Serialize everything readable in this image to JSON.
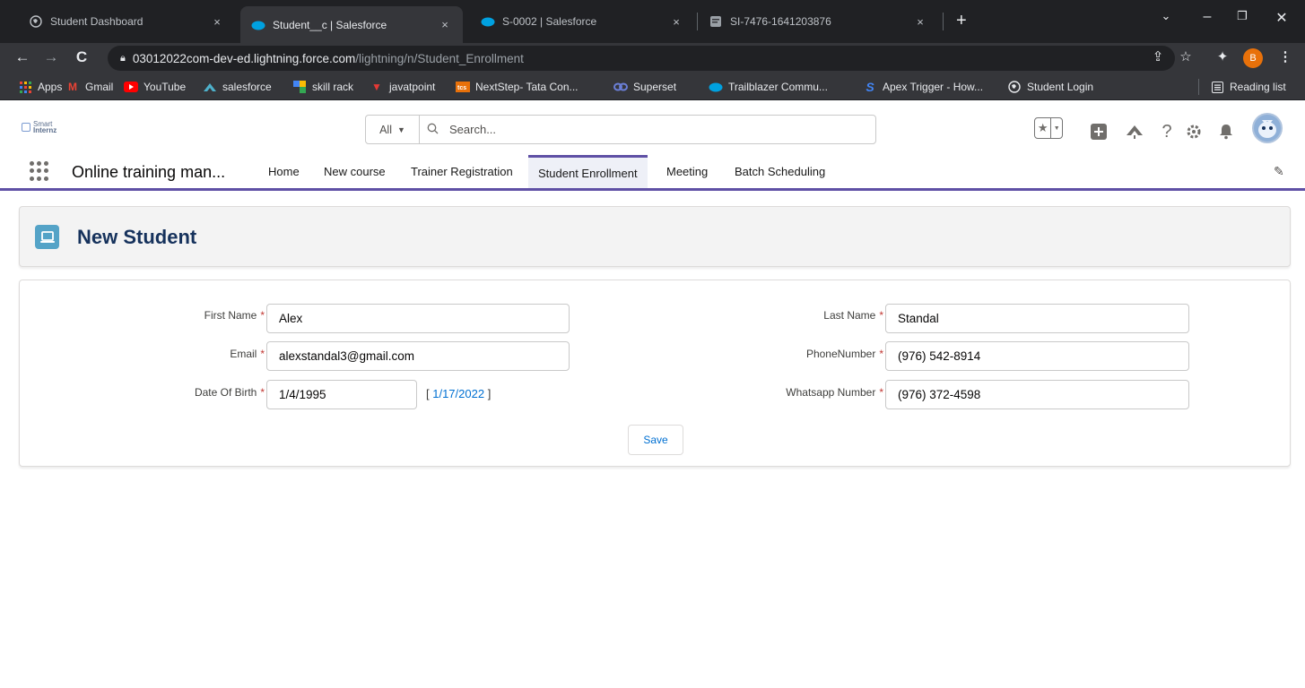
{
  "browser": {
    "tabs": [
      {
        "title": "Student Dashboard",
        "close": "×"
      },
      {
        "title": "Student__c | Salesforce",
        "close": "×"
      },
      {
        "title": "S-0002 | Salesforce",
        "close": "×"
      },
      {
        "title": "SI-7476-1641203876",
        "close": "×"
      }
    ],
    "new_tab": "+",
    "url_host": "03012022com-dev-ed.lightning.force.com",
    "url_path": "/lightning/n/Student_Enrollment",
    "profile_initial": "B",
    "bookmarks": [
      "Apps",
      "Gmail",
      "YouTube",
      "salesforce",
      "skill rack",
      "javatpoint",
      "NextStep- Tata Con...",
      "Superset",
      "Trailblazer Commu...",
      "Apex Trigger - How...",
      "Student Login"
    ],
    "reading_list": "Reading list"
  },
  "sf": {
    "logo_text_1": "Smart",
    "logo_text_2": "Internz",
    "search_scope": "All",
    "search_placeholder": "Search...",
    "app_name": "Online training man...",
    "nav": [
      "Home",
      "New course",
      "Trainer Registration",
      "Student Enrollment",
      "Meeting",
      "Batch Scheduling"
    ],
    "active_nav": "Student Enrollment"
  },
  "page": {
    "title": "New Student",
    "required_mark": "*",
    "fields": {
      "first_name": {
        "label": "First Name",
        "value": "Alex"
      },
      "last_name": {
        "label": "Last Name",
        "value": "Standal"
      },
      "email": {
        "label": "Email",
        "value": "alexstandal3@gmail.com"
      },
      "phone": {
        "label": "PhoneNumber",
        "value": "(976) 542-8914"
      },
      "dob": {
        "label": "Date Of Birth",
        "value": "1/4/1995",
        "today_open": "[ ",
        "today": "1/17/2022",
        "today_close": " ]"
      },
      "whatsapp": {
        "label": "Whatsapp Number",
        "value": "(976) 372-4598"
      }
    },
    "save_label": "Save"
  },
  "colors": {
    "brand": "#5f50a5",
    "link": "#0070d2",
    "required": "#c23934",
    "title": "#16325c",
    "icon_bg": "#54a3c7"
  }
}
